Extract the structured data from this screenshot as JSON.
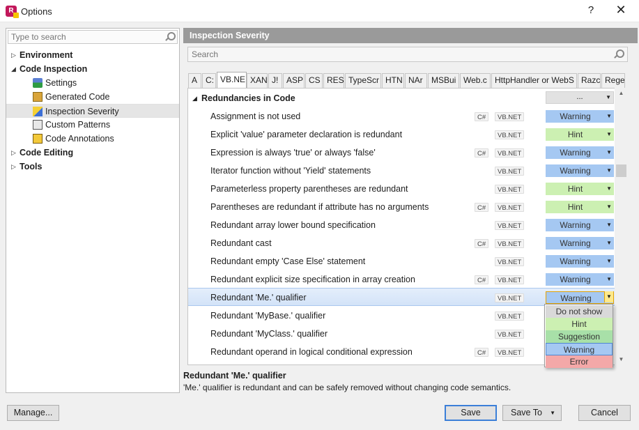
{
  "window": {
    "title": "Options",
    "help": "?",
    "close": "✕"
  },
  "left": {
    "search_placeholder": "Type to search",
    "tree": [
      {
        "label": "Environment",
        "arrow": "▷"
      },
      {
        "label": "Code Inspection",
        "arrow": "◢"
      },
      {
        "label": "Settings"
      },
      {
        "label": "Generated Code"
      },
      {
        "label": "Inspection Severity"
      },
      {
        "label": "Custom Patterns"
      },
      {
        "label": "Code Annotations"
      },
      {
        "label": "Code Editing",
        "arrow": "▷"
      },
      {
        "label": "Tools",
        "arrow": "▷"
      }
    ]
  },
  "right": {
    "header": "Inspection Severity",
    "search_placeholder": "Search",
    "tabs": [
      "A",
      "C:",
      "VB.NE",
      "XAN",
      "J!",
      "ASP",
      "CS",
      "RES",
      "TypeScr",
      "HTN",
      "NAr",
      "MSBui",
      "Web.c",
      "HttpHandler or WebS",
      "Razc",
      "Rege"
    ],
    "group": {
      "label": "Redundancies in Code",
      "selector": "..."
    },
    "lang_labels": {
      "cs": "C#",
      "vb": "VB.NET"
    },
    "rows": [
      {
        "label": "Assignment is not used",
        "severity": "Warning"
      },
      {
        "label": "Explicit 'value' parameter declaration is redundant",
        "severity": "Hint"
      },
      {
        "label": "Expression is always 'true' or always 'false'",
        "severity": "Warning"
      },
      {
        "label": "Iterator function without 'Yield' statements",
        "severity": "Warning"
      },
      {
        "label": "Parameterless property parentheses are redundant",
        "severity": "Hint"
      },
      {
        "label": "Parentheses are redundant if attribute has no arguments",
        "severity": "Hint"
      },
      {
        "label": "Redundant array lower bound specification",
        "severity": "Warning"
      },
      {
        "label": "Redundant cast",
        "severity": "Warning"
      },
      {
        "label": "Redundant empty 'Case Else' statement",
        "severity": "Warning"
      },
      {
        "label": "Redundant explicit size specification in array creation",
        "severity": "Warning"
      },
      {
        "label": "Redundant 'Me.' qualifier",
        "severity": "Warning"
      },
      {
        "label": "Redundant 'MyBase.' qualifier",
        "severity": ""
      },
      {
        "label": "Redundant 'MyClass.' qualifier",
        "severity": ""
      },
      {
        "label": "Redundant operand in logical conditional expression",
        "severity": ""
      }
    ],
    "dropdown": [
      "Do not show",
      "Hint",
      "Suggestion",
      "Warning",
      "Error"
    ],
    "description": {
      "title": "Redundant 'Me.' qualifier",
      "text": "'Me.' qualifier is redundant and can be safely removed without changing code semantics."
    }
  },
  "buttons": {
    "manage": "Manage...",
    "save": "Save",
    "save_to": "Save To",
    "cancel": "Cancel"
  },
  "colors": {
    "warning": "#a5c8f2",
    "hint": "#ccf0b2",
    "suggestion": "#a8e0a8",
    "error": "#f4a8a8",
    "header": "#9a9a9a"
  }
}
